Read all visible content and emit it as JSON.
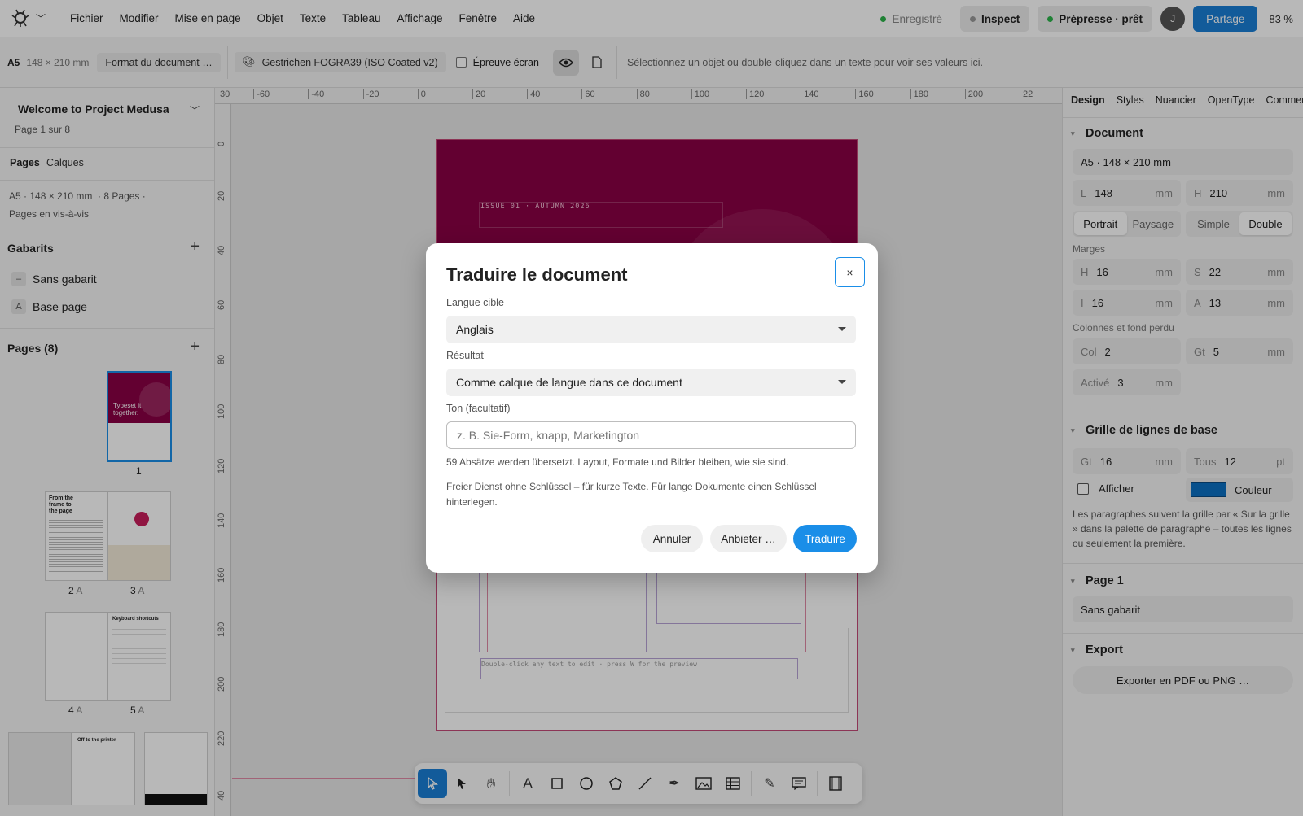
{
  "menubar": {
    "items": [
      "Fichier",
      "Modifier",
      "Mise en page",
      "Objet",
      "Texte",
      "Tableau",
      "Affichage",
      "Fenêtre",
      "Aide"
    ],
    "saved": "Enregistré",
    "inspect": "Inspect",
    "prepress": "Prépresse · prêt",
    "avatar": "J",
    "share": "Partage",
    "zoom": "83 %"
  },
  "toolbar": {
    "format": "A5",
    "size": "148 × 210 mm",
    "doc_format": "Format du document …",
    "profile": "Gestrichen FOGRA39 (ISO Coated v2)",
    "proof": "Épreuve écran",
    "hint": "Sélectionnez un objet ou double-cliquez dans un texte pour voir ses valeurs ici."
  },
  "left": {
    "project": "Welcome to Project Medusa",
    "page_info": "Page 1 sur 8",
    "tabs": [
      "Pages",
      "Calques"
    ],
    "doc_meta": "A5 · 148 × 210 mm  · 8 Pages ·",
    "spread": "Pages en vis-à-vis",
    "gabarits_title": "Gabarits",
    "gabarits": [
      {
        "badge": "–",
        "label": "Sans gabarit"
      },
      {
        "badge": "A",
        "label": "Base page"
      }
    ],
    "pages_title": "Pages (8)",
    "page_labels": [
      "1",
      "2",
      "A",
      "3",
      "A",
      "4",
      "A",
      "5",
      "A"
    ],
    "thumb_texts": {
      "cover": "Typeset it together.",
      "p2": "From the frame to the page",
      "p5": "Keyboard shortcuts",
      "p7": "Off to the printer"
    }
  },
  "ruler": {
    "top": [
      "30",
      "-60",
      "-40",
      "-20",
      "0",
      "20",
      "40",
      "60",
      "80",
      "100",
      "120",
      "140",
      "160",
      "180",
      "200",
      "22"
    ],
    "left": [
      "0",
      "20",
      "40",
      "60",
      "80",
      "100",
      "120",
      "140",
      "160",
      "180",
      "200",
      "220",
      "40"
    ]
  },
  "canvas": {
    "issue": "ISSUE 01 · AUTUMN 2026",
    "footer_hint": "Double-click any text to edit · press W for the preview"
  },
  "right": {
    "tabs": [
      "Design",
      "Styles",
      "Nuancier",
      "OpenType",
      "Commentai"
    ],
    "document_title": "Document",
    "doc_size": "A5 · 148 × 210 mm",
    "width_lbl": "L",
    "width": "148",
    "height_lbl": "H",
    "height": "210",
    "unit": "mm",
    "orient": [
      "Portrait",
      "Paysage"
    ],
    "sides": [
      "Simple",
      "Double"
    ],
    "margins_title": "Marges",
    "m_h_lbl": "H",
    "m_h": "16",
    "m_s_lbl": "S",
    "m_s": "22",
    "m_i_lbl": "I",
    "m_i": "16",
    "m_a_lbl": "A",
    "m_a": "13",
    "cols_title": "Colonnes et fond perdu",
    "col_lbl": "Col",
    "col": "2",
    "gt_lbl": "Gt",
    "gt": "5",
    "active_lbl": "Activé",
    "active": "3",
    "baseline_title": "Grille de lignes de base",
    "bl_gt": "16",
    "bl_all_lbl": "Tous",
    "bl_all": "12",
    "pt": "pt",
    "show": "Afficher",
    "color": "Couleur",
    "baseline_note": "Les paragraphes suivent la grille par « Sur la grille » dans la palette de paragraphe – toutes les lignes ou seulement la première.",
    "page_title": "Page 1",
    "page_master": "Sans gabarit",
    "export_title": "Export",
    "export_btn": "Exporter en PDF ou PNG …"
  },
  "dialog": {
    "title": "Traduire le document",
    "close": "×",
    "lang_label": "Langue cible",
    "lang_value": "Anglais",
    "result_label": "Résultat",
    "result_value": "Comme calque de langue dans ce document",
    "tone_label": "Ton (facultatif)",
    "tone_placeholder": "z. B. Sie-Form, knapp, Marketington",
    "info": "59 Absätze werden übersetzt. Layout, Formate und Bilder bleiben, wie sie sind.",
    "note": "Freier Dienst ohne Schlüssel – für kurze Texte. Für lange Dokumente einen Schlüssel hinterlegen.",
    "cancel": "Annuler",
    "provider": "Anbieter …",
    "translate": "Traduire"
  },
  "colors": {
    "accent": "#1a8ee8",
    "magenta": "#8a0044",
    "green": "#2bb34a"
  }
}
